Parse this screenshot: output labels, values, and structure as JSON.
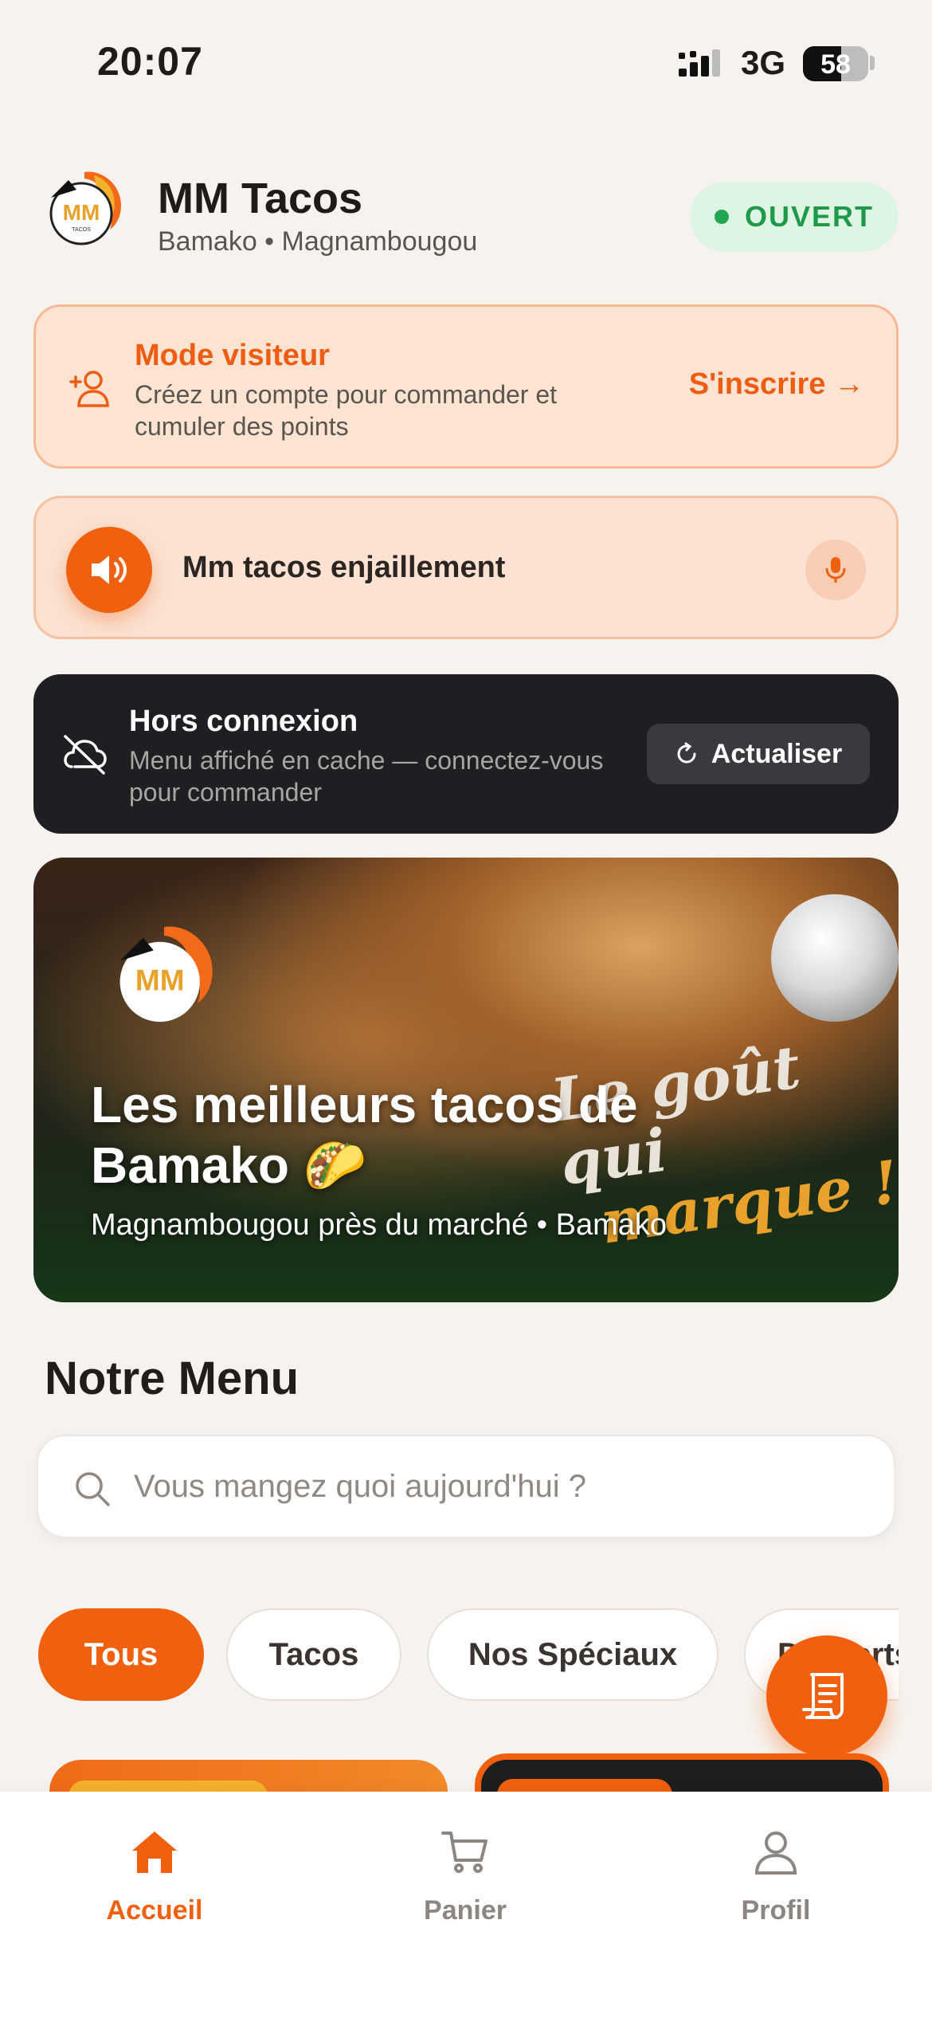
{
  "status_bar": {
    "time": "20:07",
    "network": "3G",
    "battery": "58"
  },
  "header": {
    "store_name": "MM Tacos",
    "location": "Bamako • Magnambougou",
    "status": "OUVERT"
  },
  "visitor_banner": {
    "title": "Mode visiteur",
    "description": "Créez un compte pour commander et cumuler des points",
    "signup_label": "S'inscrire →"
  },
  "audio_bar": {
    "title": "Mm tacos enjaillement"
  },
  "offline_card": {
    "title": "Hors connexion",
    "description": "Menu affiché en cache — connectez-vous pour commander",
    "refresh_label": "Actualiser"
  },
  "hero": {
    "title": "Les meilleurs tacos de Bamako 🌮",
    "subtitle": "Magnambougou près du marché • Bamako",
    "slogan_line1": "Le goût qui",
    "slogan_line2": "marque !"
  },
  "menu": {
    "title": "Notre Menu",
    "search_placeholder": "Vous mangez quoi aujourd'hui ?",
    "categories": [
      "Tous",
      "Tacos",
      "Nos Spéciaux",
      "Desserts"
    ],
    "active_category": "Tous"
  },
  "bottom_nav": {
    "items": [
      {
        "label": "Accueil",
        "icon": "home-icon",
        "active": true
      },
      {
        "label": "Panier",
        "icon": "cart-icon",
        "active": false
      },
      {
        "label": "Profil",
        "icon": "profile-icon",
        "active": false
      }
    ]
  },
  "colors": {
    "accent": "#f0600f",
    "open_green": "#1f9a4a",
    "background": "#f6f3ef",
    "offline_bg": "#1f1e22"
  }
}
